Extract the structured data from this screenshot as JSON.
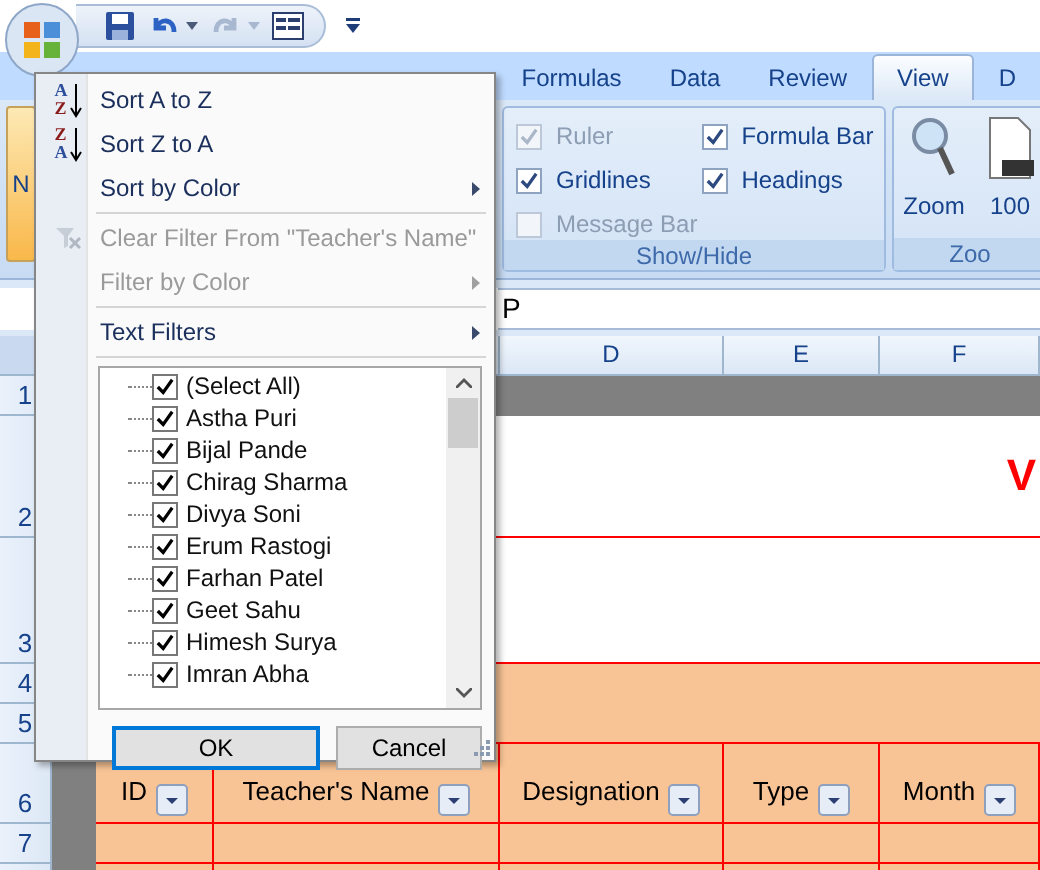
{
  "ribbon": {
    "tabs": [
      {
        "label": "Formulas",
        "selected": false
      },
      {
        "label": "Data",
        "selected": false
      },
      {
        "label": "Review",
        "selected": false
      },
      {
        "label": "View",
        "selected": true
      },
      {
        "label": "D",
        "selected": false
      }
    ],
    "left_button": {
      "label": "N",
      "selected": true
    },
    "show_hide": {
      "title": "Show/Hide",
      "options": [
        {
          "label": "Ruler",
          "checked": true,
          "disabled": true
        },
        {
          "label": "Gridlines",
          "checked": true,
          "disabled": false
        },
        {
          "label": "Message Bar",
          "checked": false,
          "disabled": true
        },
        {
          "label": "Formula Bar",
          "checked": true,
          "disabled": false
        },
        {
          "label": "Headings",
          "checked": true,
          "disabled": false
        }
      ]
    },
    "zoom": {
      "title": "Zoo",
      "buttons": [
        {
          "kind": "zoom",
          "label": "Zoom"
        },
        {
          "kind": "percent",
          "label": "100"
        }
      ]
    }
  },
  "formula_bar": {
    "value": "P"
  },
  "sheet": {
    "columns": [
      "D",
      "E",
      "F"
    ],
    "rows": [
      "1",
      "2",
      "3",
      "4",
      "5",
      "6",
      "7"
    ],
    "title": "V",
    "headers": [
      {
        "label": "ID"
      },
      {
        "label": "Teacher's Name"
      },
      {
        "label": "Designation"
      },
      {
        "label": "Type"
      },
      {
        "label": "Month"
      }
    ]
  },
  "filter_menu": {
    "items": [
      {
        "kind": "sort-asc",
        "icon_letters": [
          "A",
          "Z"
        ],
        "label": "Sort A to Z",
        "disabled": false,
        "submenu": false
      },
      {
        "kind": "sort-desc",
        "icon_letters": [
          "Z",
          "A"
        ],
        "label": "Sort Z to A",
        "disabled": false,
        "submenu": false
      },
      {
        "kind": "plain",
        "label": "Sort by Color",
        "disabled": false,
        "submenu": true
      },
      {
        "kind": "clear",
        "label": "Clear Filter From \"Teacher's Name\"",
        "disabled": true,
        "submenu": false
      },
      {
        "kind": "plain",
        "label": "Filter by Color",
        "disabled": true,
        "submenu": true
      },
      {
        "kind": "plain",
        "label": "Text Filters",
        "disabled": false,
        "submenu": true
      }
    ],
    "values": [
      {
        "label": "(Select All)",
        "checked": true
      },
      {
        "label": "Astha Puri",
        "checked": true
      },
      {
        "label": "Bijal Pande",
        "checked": true
      },
      {
        "label": "Chirag Sharma",
        "checked": true
      },
      {
        "label": "Divya Soni",
        "checked": true
      },
      {
        "label": "Erum Rastogi",
        "checked": true
      },
      {
        "label": "Farhan Patel",
        "checked": true
      },
      {
        "label": "Geet Sahu",
        "checked": true
      },
      {
        "label": "Himesh Surya",
        "checked": true
      },
      {
        "label": "Imran Abha",
        "checked": true
      }
    ],
    "buttons": [
      {
        "label": "OK",
        "selected": true
      },
      {
        "label": "Cancel",
        "selected": false
      }
    ]
  }
}
